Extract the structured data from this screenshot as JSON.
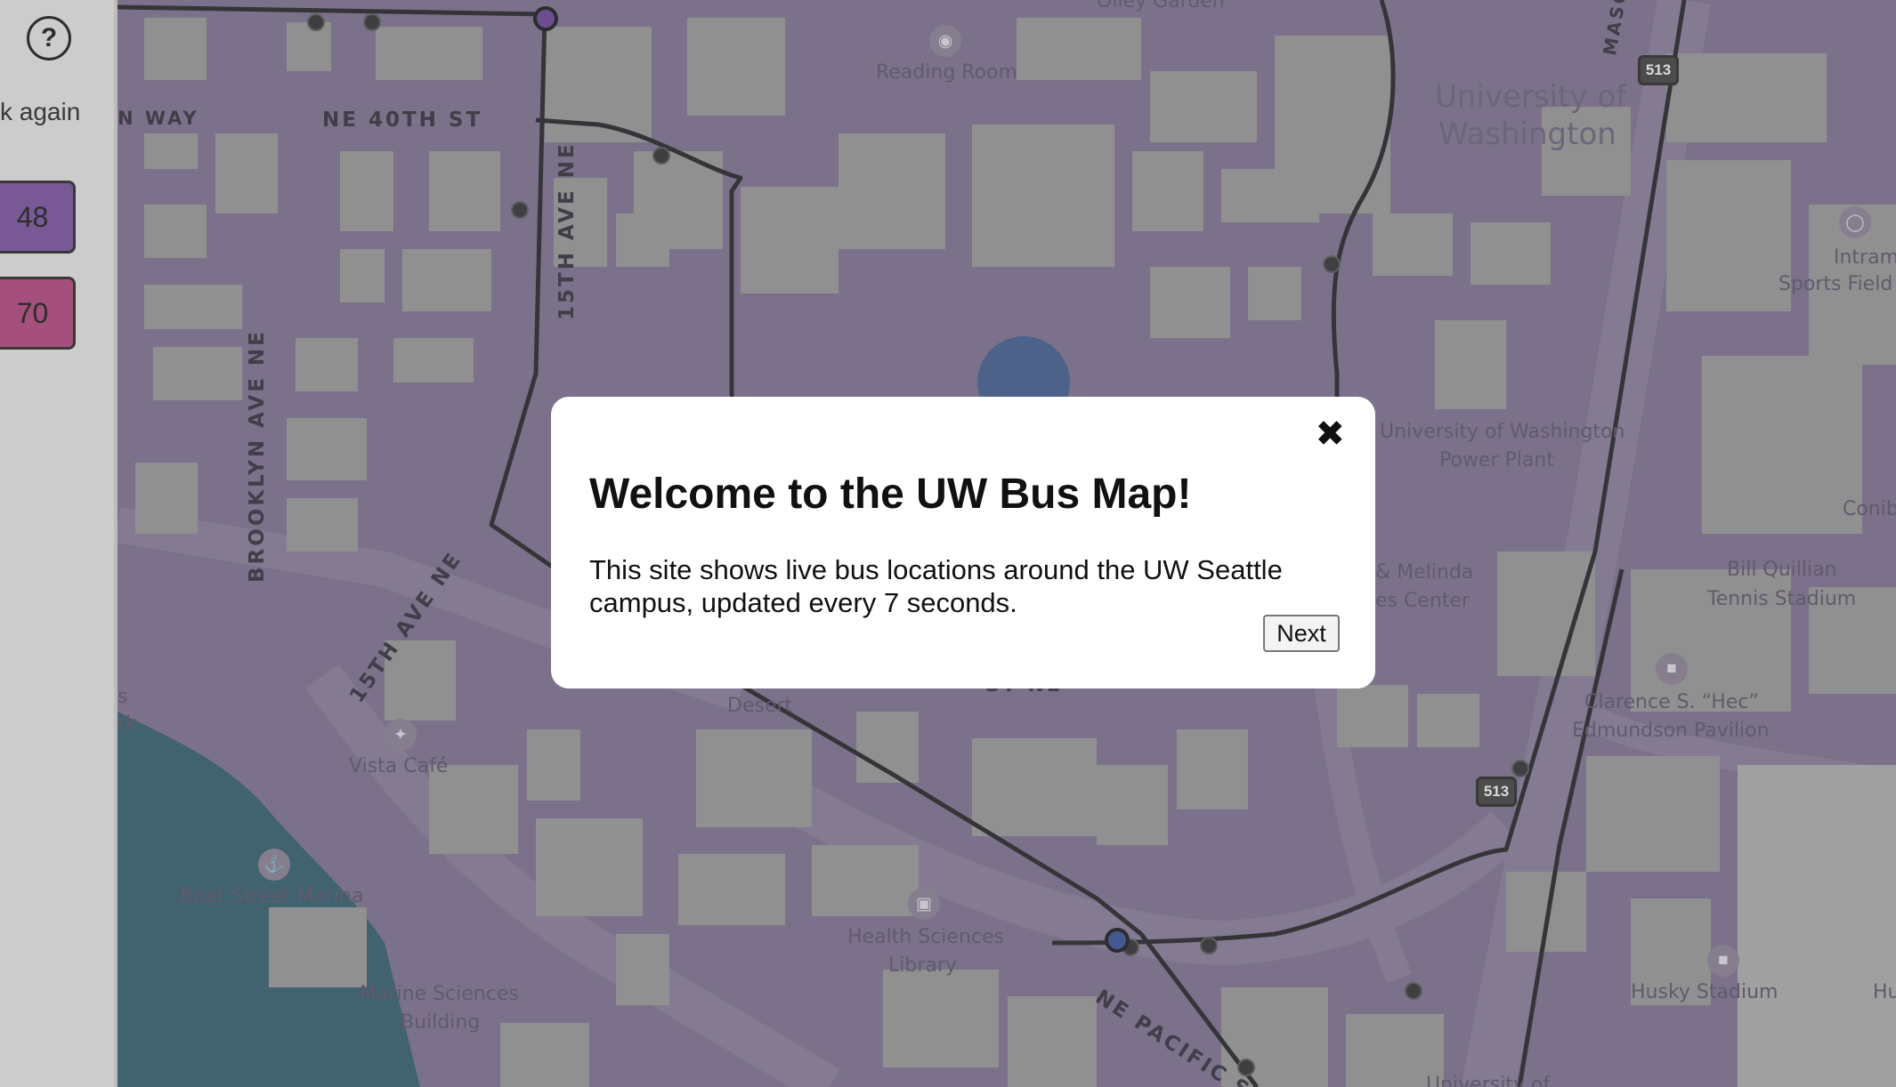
{
  "sidebar": {
    "help_label": "?",
    "check_again": "k again",
    "routes": [
      {
        "label": "48",
        "color": "#7a4ea1"
      },
      {
        "label": "70",
        "color": "#b8427e"
      }
    ]
  },
  "map": {
    "streets": {
      "ne_40th": "NE 40TH ST",
      "n_way": "N WAY",
      "15th_ave_ne_top": "15TH AVE NE",
      "brooklyn": "BROOKLYN AVE NE",
      "15th_ave_ne_bottom": "15TH AVE NE",
      "ne_pacific": "NE PACIFIC S"
    },
    "places": {
      "olley_garden": "Olley Garden",
      "reading_room": "Reading Room",
      "uw_line1": "University of",
      "uw_line2": "Washington",
      "power_plant_1": "University of Washington",
      "power_plant_2": "Power Plant",
      "intramural_1": "Intramura",
      "intramural_2": "Sports Field",
      "conib": "Conib",
      "melinda_1": "& Melinda",
      "melinda_2": "es Center",
      "bill_1": "Bill Quillian",
      "bill_2": "Tennis Stadium",
      "hec_1": "Clarence S. “Hec”",
      "hec_2": "Edmundson Pavilion",
      "desert": "Desert",
      "vista": "Vista Café",
      "marina": "Boat Street Marina",
      "marine_1": "Marine Sciences",
      "marine_2": "Building",
      "health_1": "Health Sciences",
      "health_2": "Library",
      "husky": "Husky Stadium",
      "hu": "Hu",
      "university_bottom": "University of",
      "rk": "rk",
      "s": "s",
      "masc": "MASO",
      "st_ne": "ST NE"
    },
    "shields": [
      "513",
      "513"
    ]
  },
  "modal": {
    "close_label": "✖",
    "title": "Welcome to the UW Bus Map!",
    "body": "This site shows live bus locations around the UW Seattle campus, updated every 7 seconds.",
    "next_label": "Next"
  }
}
